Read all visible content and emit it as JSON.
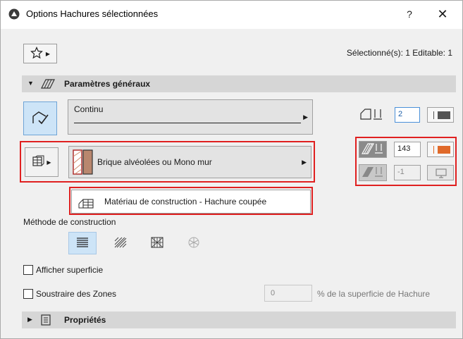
{
  "window": {
    "title": "Options Hachures sélectionnées",
    "help_label": "?",
    "close_label": "✕"
  },
  "header": {
    "favorites_icon": "star-icon",
    "selection_info": "Sélectionné(s): 1 Editable: 1"
  },
  "general": {
    "label": "Paramètres généraux",
    "line_type": "Continu",
    "line_pen_value": "2",
    "fill_pen_value": "143",
    "bg_pen_value": "-1",
    "fill_name": "Brique alvéolées ou Mono mur",
    "material_label": "Matériau de construction - Hachure coupée",
    "method_label": "Méthode de construction",
    "show_area_label": "Afficher superficie",
    "subtract_zones_label": "Soustraire des Zones",
    "percent_value": "0",
    "percent_label": "% de la superficie de Hachure",
    "fill_pen_color": "#e06a2a",
    "line_pen_color": "#555555",
    "bg_pen_color": "#888888"
  },
  "properties": {
    "label": "Propriétés"
  }
}
